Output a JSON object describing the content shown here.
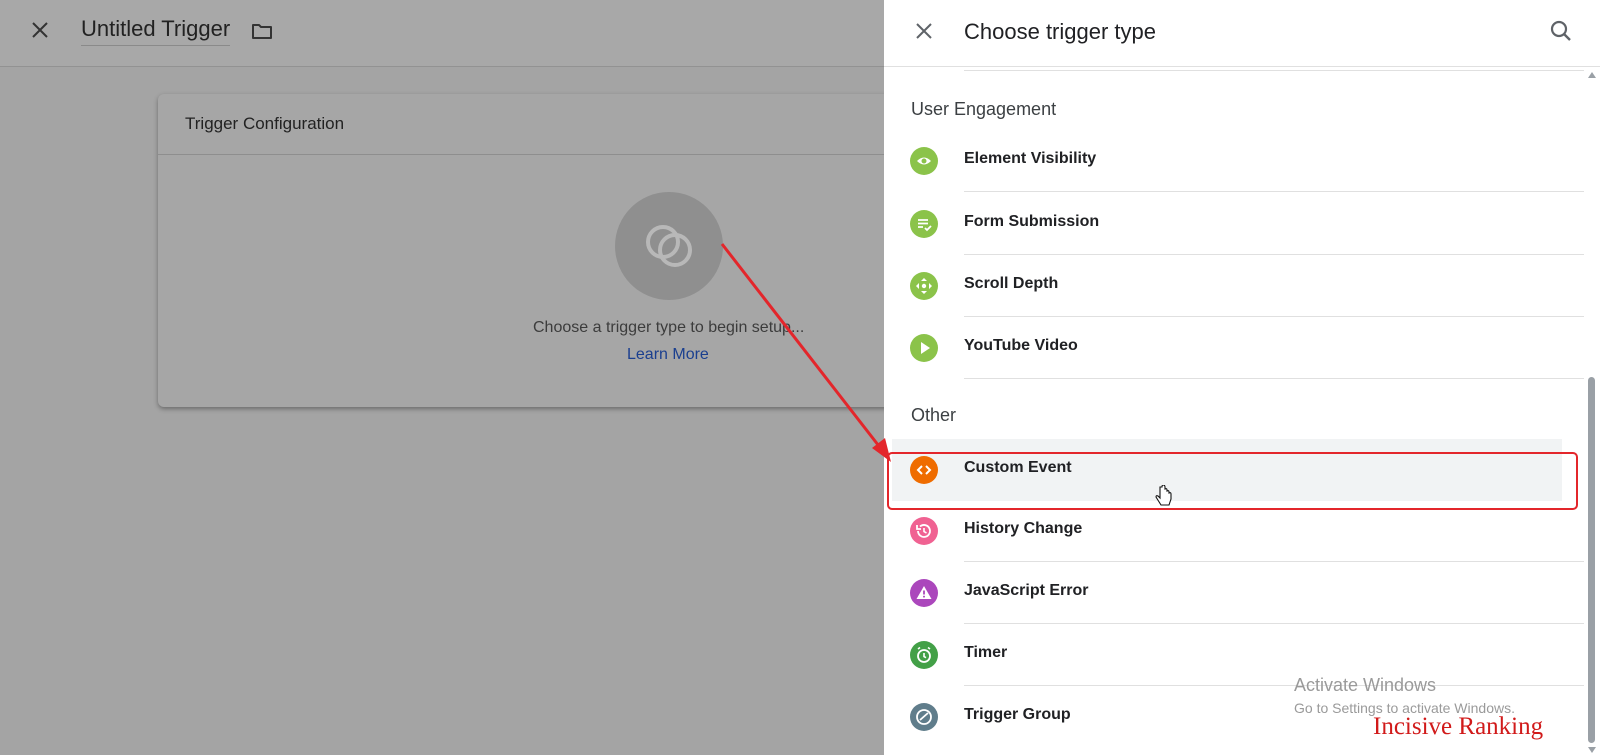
{
  "editor": {
    "title": "Untitled Trigger",
    "card_title": "Trigger Configuration",
    "prompt": "Choose a trigger type to begin setup...",
    "learn_more": "Learn More"
  },
  "panel": {
    "title": "Choose trigger type",
    "sections": [
      {
        "title": "User Engagement",
        "items": [
          {
            "label": "Element Visibility",
            "icon": "eye-icon",
            "color": "#8bc34a"
          },
          {
            "label": "Form Submission",
            "icon": "form-check-icon",
            "color": "#8bc34a"
          },
          {
            "label": "Scroll Depth",
            "icon": "move-arrows-icon",
            "color": "#8bc34a"
          },
          {
            "label": "YouTube Video",
            "icon": "play-icon",
            "color": "#8bc34a"
          }
        ]
      },
      {
        "title": "Other",
        "items": [
          {
            "label": "Custom Event",
            "icon": "code-brackets-icon",
            "color": "#ef6c00",
            "highlighted": true
          },
          {
            "label": "History Change",
            "icon": "history-icon",
            "color": "#f06292"
          },
          {
            "label": "JavaScript Error",
            "icon": "warning-icon",
            "color": "#ab47bc"
          },
          {
            "label": "Timer",
            "icon": "alarm-clock-icon",
            "color": "#43a047"
          },
          {
            "label": "Trigger Group",
            "icon": "trigger-group-icon",
            "color": "#607d8b"
          }
        ]
      }
    ]
  },
  "overlay": {
    "activate_title": "Activate Windows",
    "activate_sub": "Go to Settings to activate Windows.",
    "brand": "Incisive Ranking",
    "annotation_color": "#e3262b"
  }
}
